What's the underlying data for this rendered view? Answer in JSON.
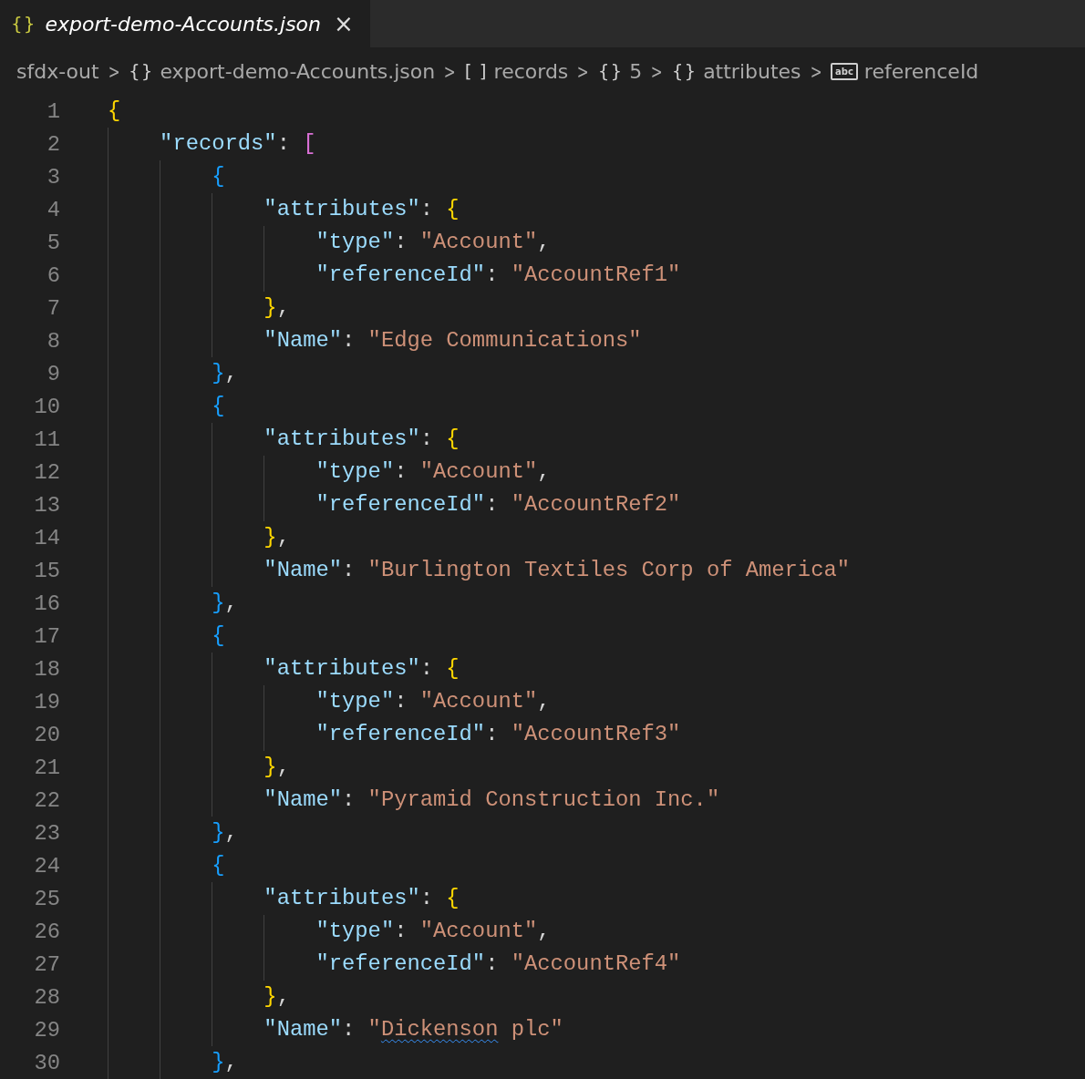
{
  "tabs": [
    {
      "icon_text": "{}",
      "label": "export-demo-Accounts.json",
      "close": "×",
      "selected": true
    }
  ],
  "breadcrumb": [
    {
      "label": "sfdx-out"
    },
    {
      "icon_text": "{}",
      "label": "export-demo-Accounts.json"
    },
    {
      "icon_text": "[ ]",
      "label": "records"
    },
    {
      "icon_text": "{}",
      "label": "5"
    },
    {
      "icon_text": "{}",
      "label": "attributes"
    },
    {
      "icon_text": "abc",
      "kind": "string",
      "label": "referenceId"
    }
  ],
  "separator": ">",
  "lines": [
    {
      "number": "1",
      "tokens": [
        {
          "kind": "bracket",
          "t": "{",
          "color": "#ffd700"
        }
      ],
      "children": [
        {
          "number": "2",
          "tokens": [
            {
              "kind": "key",
              "t": "\"records\""
            },
            {
              "kind": "punct",
              "t": ": "
            },
            {
              "kind": "bracket",
              "t": "[",
              "color": "#da70d6"
            }
          ],
          "children": [
            {
              "number": "3",
              "tokens": [
                {
                  "kind": "bracket",
                  "t": "{",
                  "color": "#179fff"
                }
              ],
              "children": [
                {
                  "number": "4",
                  "tokens": [
                    {
                      "kind": "key",
                      "t": "\"attributes\""
                    },
                    {
                      "kind": "punct",
                      "t": ": "
                    },
                    {
                      "kind": "bracket",
                      "t": "{",
                      "color": "#ffd700"
                    }
                  ],
                  "children": [
                    {
                      "number": "5",
                      "tokens": [
                        {
                          "kind": "key",
                          "t": "\"type\""
                        },
                        {
                          "kind": "punct",
                          "t": ": "
                        },
                        {
                          "kind": "string",
                          "t": "\"Account\""
                        },
                        {
                          "kind": "punct",
                          "t": ","
                        }
                      ]
                    },
                    {
                      "number": "6",
                      "tokens": [
                        {
                          "kind": "key",
                          "t": "\"referenceId\""
                        },
                        {
                          "kind": "punct",
                          "t": ": "
                        },
                        {
                          "kind": "string",
                          "t": "\"AccountRef1\""
                        }
                      ]
                    }
                  ]
                },
                {
                  "number": "7",
                  "tokens": [
                    {
                      "kind": "bracket",
                      "t": "}",
                      "color": "#ffd700"
                    },
                    {
                      "kind": "punct",
                      "t": ","
                    }
                  ]
                },
                {
                  "number": "8",
                  "tokens": [
                    {
                      "kind": "key",
                      "t": "\"Name\""
                    },
                    {
                      "kind": "punct",
                      "t": ": "
                    },
                    {
                      "kind": "string",
                      "t": "\"Edge Communications\""
                    }
                  ]
                }
              ]
            },
            {
              "number": "9",
              "tokens": [
                {
                  "kind": "bracket",
                  "t": "}",
                  "color": "#179fff"
                },
                {
                  "kind": "punct",
                  "t": ","
                }
              ]
            },
            {
              "number": "10",
              "tokens": [
                {
                  "kind": "bracket",
                  "t": "{",
                  "color": "#179fff"
                }
              ],
              "children": [
                {
                  "number": "11",
                  "tokens": [
                    {
                      "kind": "key",
                      "t": "\"attributes\""
                    },
                    {
                      "kind": "punct",
                      "t": ": "
                    },
                    {
                      "kind": "bracket",
                      "t": "{",
                      "color": "#ffd700"
                    }
                  ],
                  "children": [
                    {
                      "number": "12",
                      "tokens": [
                        {
                          "kind": "key",
                          "t": "\"type\""
                        },
                        {
                          "kind": "punct",
                          "t": ": "
                        },
                        {
                          "kind": "string",
                          "t": "\"Account\""
                        },
                        {
                          "kind": "punct",
                          "t": ","
                        }
                      ]
                    },
                    {
                      "number": "13",
                      "tokens": [
                        {
                          "kind": "key",
                          "t": "\"referenceId\""
                        },
                        {
                          "kind": "punct",
                          "t": ": "
                        },
                        {
                          "kind": "string",
                          "t": "\"AccountRef2\""
                        }
                      ]
                    }
                  ]
                },
                {
                  "number": "14",
                  "tokens": [
                    {
                      "kind": "bracket",
                      "t": "}",
                      "color": "#ffd700"
                    },
                    {
                      "kind": "punct",
                      "t": ","
                    }
                  ]
                },
                {
                  "number": "15",
                  "tokens": [
                    {
                      "kind": "key",
                      "t": "\"Name\""
                    },
                    {
                      "kind": "punct",
                      "t": ": "
                    },
                    {
                      "kind": "string",
                      "t": "\"Burlington Textiles Corp of America\""
                    }
                  ]
                }
              ]
            },
            {
              "number": "16",
              "tokens": [
                {
                  "kind": "bracket",
                  "t": "}",
                  "color": "#179fff"
                },
                {
                  "kind": "punct",
                  "t": ","
                }
              ]
            },
            {
              "number": "17",
              "tokens": [
                {
                  "kind": "bracket",
                  "t": "{",
                  "color": "#179fff"
                }
              ],
              "children": [
                {
                  "number": "18",
                  "tokens": [
                    {
                      "kind": "key",
                      "t": "\"attributes\""
                    },
                    {
                      "kind": "punct",
                      "t": ": "
                    },
                    {
                      "kind": "bracket",
                      "t": "{",
                      "color": "#ffd700"
                    }
                  ],
                  "children": [
                    {
                      "number": "19",
                      "tokens": [
                        {
                          "kind": "key",
                          "t": "\"type\""
                        },
                        {
                          "kind": "punct",
                          "t": ": "
                        },
                        {
                          "kind": "string",
                          "t": "\"Account\""
                        },
                        {
                          "kind": "punct",
                          "t": ","
                        }
                      ]
                    },
                    {
                      "number": "20",
                      "tokens": [
                        {
                          "kind": "key",
                          "t": "\"referenceId\""
                        },
                        {
                          "kind": "punct",
                          "t": ": "
                        },
                        {
                          "kind": "string",
                          "t": "\"AccountRef3\""
                        }
                      ]
                    }
                  ]
                },
                {
                  "number": "21",
                  "tokens": [
                    {
                      "kind": "bracket",
                      "t": "}",
                      "color": "#ffd700"
                    },
                    {
                      "kind": "punct",
                      "t": ","
                    }
                  ]
                },
                {
                  "number": "22",
                  "tokens": [
                    {
                      "kind": "key",
                      "t": "\"Name\""
                    },
                    {
                      "kind": "punct",
                      "t": ": "
                    },
                    {
                      "kind": "string",
                      "t": "\"Pyramid Construction Inc.\""
                    }
                  ]
                }
              ]
            },
            {
              "number": "23",
              "tokens": [
                {
                  "kind": "bracket",
                  "t": "}",
                  "color": "#179fff"
                },
                {
                  "kind": "punct",
                  "t": ","
                }
              ]
            },
            {
              "number": "24",
              "tokens": [
                {
                  "kind": "bracket",
                  "t": "{",
                  "color": "#179fff"
                }
              ],
              "children": [
                {
                  "number": "25",
                  "tokens": [
                    {
                      "kind": "key",
                      "t": "\"attributes\""
                    },
                    {
                      "kind": "punct",
                      "t": ": "
                    },
                    {
                      "kind": "bracket",
                      "t": "{",
                      "color": "#ffd700"
                    }
                  ],
                  "children": [
                    {
                      "number": "26",
                      "tokens": [
                        {
                          "kind": "key",
                          "t": "\"type\""
                        },
                        {
                          "kind": "punct",
                          "t": ": "
                        },
                        {
                          "kind": "string",
                          "t": "\"Account\""
                        },
                        {
                          "kind": "punct",
                          "t": ","
                        }
                      ]
                    },
                    {
                      "number": "27",
                      "tokens": [
                        {
                          "kind": "key",
                          "t": "\"referenceId\""
                        },
                        {
                          "kind": "punct",
                          "t": ": "
                        },
                        {
                          "kind": "string",
                          "t": "\"AccountRef4\""
                        }
                      ]
                    }
                  ]
                },
                {
                  "number": "28",
                  "tokens": [
                    {
                      "kind": "bracket",
                      "t": "}",
                      "color": "#ffd700"
                    },
                    {
                      "kind": "punct",
                      "t": ","
                    }
                  ]
                },
                {
                  "number": "29",
                  "tokens": [
                    {
                      "kind": "key",
                      "t": "\"Name\""
                    },
                    {
                      "kind": "punct",
                      "t": ": "
                    },
                    {
                      "kind": "string",
                      "t": "\""
                    },
                    {
                      "kind": "misspelled",
                      "t": "Dickenson"
                    },
                    {
                      "kind": "string",
                      "t": " plc\""
                    }
                  ]
                }
              ]
            },
            {
              "number": "30",
              "tokens": [
                {
                  "kind": "bracket",
                  "t": "}",
                  "color": "#179fff"
                },
                {
                  "kind": "punct",
                  "t": ","
                }
              ]
            }
          ]
        }
      ]
    }
  ]
}
